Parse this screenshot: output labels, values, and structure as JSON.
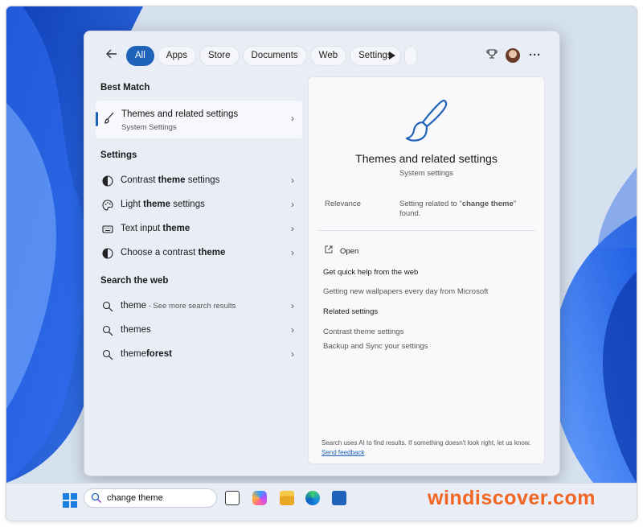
{
  "header": {
    "tabs": [
      {
        "label": "All",
        "active": true
      },
      {
        "label": "Apps"
      },
      {
        "label": "Store"
      },
      {
        "label": "Documents"
      },
      {
        "label": "Web"
      },
      {
        "label": "Settings"
      }
    ]
  },
  "best_match": {
    "heading": "Best Match",
    "title": "Themes and related settings",
    "subtitle": "System Settings",
    "icon": "brush-icon"
  },
  "settings_section": {
    "heading": "Settings",
    "items": [
      {
        "prefix": "Contrast ",
        "bold": "theme",
        "suffix": " settings",
        "icon": "contrast-icon"
      },
      {
        "prefix": "Light ",
        "bold": "theme",
        "suffix": " settings",
        "icon": "palette-icon"
      },
      {
        "prefix": "Text input ",
        "bold": "theme",
        "suffix": "",
        "icon": "keyboard-icon"
      },
      {
        "prefix": "Choose a contrast ",
        "bold": "theme",
        "suffix": "",
        "icon": "contrast-icon"
      }
    ]
  },
  "web_section": {
    "heading": "Search the web",
    "items": [
      {
        "prefix": "",
        "bold": "",
        "suffix": "theme",
        "sub": " - See more search results",
        "icon": "search-icon"
      },
      {
        "prefix": "",
        "bold": "",
        "suffix": "themes",
        "sub": "",
        "icon": "search-icon"
      },
      {
        "prefix": "theme",
        "bold": "forest",
        "suffix": "",
        "sub": "",
        "icon": "search-icon"
      }
    ]
  },
  "detail": {
    "title": "Themes and related settings",
    "subtitle": "System settings",
    "relevance_label": "Relevance",
    "relevance_value_prefix": "Setting related to \"",
    "relevance_value_bold": "change theme",
    "relevance_value_suffix": "\" found.",
    "open_label": "Open",
    "quick_help_heading": "Get quick help from the web",
    "quick_help_link": "Getting new wallpapers every day from Microsoft",
    "related_heading": "Related settings",
    "related_links": [
      "Contrast theme settings",
      "Backup and Sync your settings"
    ],
    "footer_text": "Search uses AI to find results. If something doesn't look right, let us know.",
    "feedback_link": "Send feedback"
  },
  "taskbar": {
    "search_value": "change theme"
  },
  "watermark": "windiscover.com",
  "colors": {
    "accent": "#1e62b9",
    "wallpaper_blue": "#1f4fd6",
    "watermark": "#f26522"
  }
}
